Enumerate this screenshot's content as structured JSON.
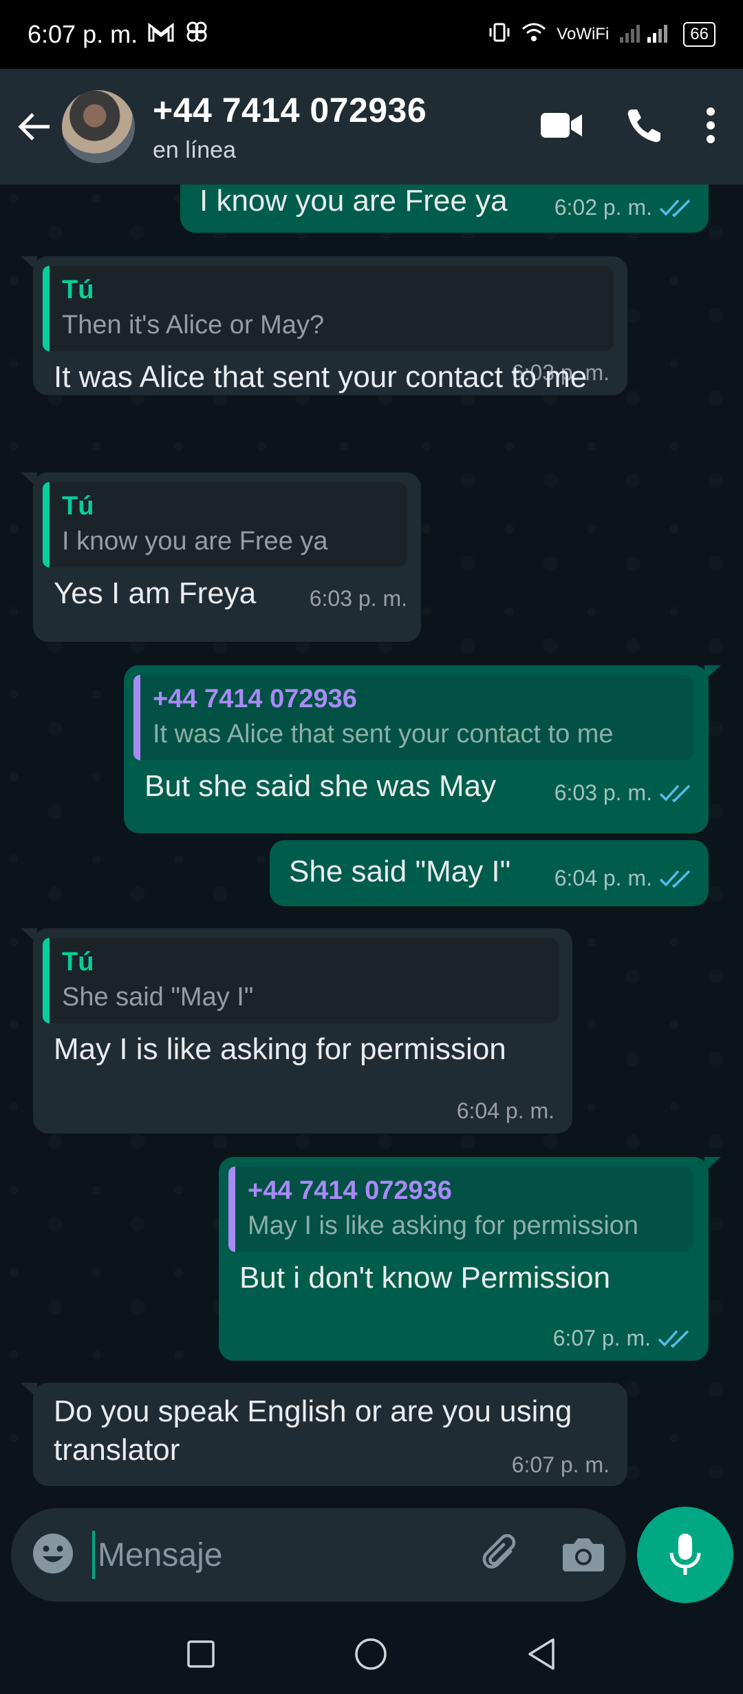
{
  "status_bar": {
    "time": "6:07 p. m.",
    "network_label": "VoWiFi",
    "battery": "66"
  },
  "header": {
    "contact": "+44 7414 072936",
    "status": "en línea"
  },
  "messages": [
    {
      "text": "I know you are Free ya",
      "time": "6:02 p. m.",
      "read": true
    },
    {
      "quote_author": "Tú",
      "quote_text": "Then it's Alice or May?",
      "text": "It was Alice that sent your contact to me",
      "time": "6:03 p. m."
    },
    {
      "quote_author": "Tú",
      "quote_text": "I know you are Free ya",
      "text": "Yes I am Freya",
      "time": "6:03 p. m."
    },
    {
      "quote_author": "+44 7414 072936",
      "quote_text": "It was Alice that sent your contact to me",
      "text": "But she said she was May",
      "time": "6:03 p. m.",
      "read": true
    },
    {
      "text": "She said \"May I\"",
      "time": "6:04 p. m.",
      "read": true
    },
    {
      "quote_author": "Tú",
      "quote_text": "She said \"May I\"",
      "text": "May I is like asking for permission",
      "time": "6:04 p. m."
    },
    {
      "quote_author": "+44 7414 072936",
      "quote_text": "May I is like asking for permission",
      "text": "But i don't know Permission",
      "time": "6:07 p. m.",
      "read": true
    },
    {
      "text": "Do you speak English or are you using translator",
      "time": "6:07 p. m."
    }
  ],
  "composer": {
    "placeholder": "Mensaje"
  },
  "colors": {
    "accent": "#00a884",
    "outgoing": "#005c4b",
    "incoming": "#202c33",
    "read_ticks": "#53bdeb"
  }
}
